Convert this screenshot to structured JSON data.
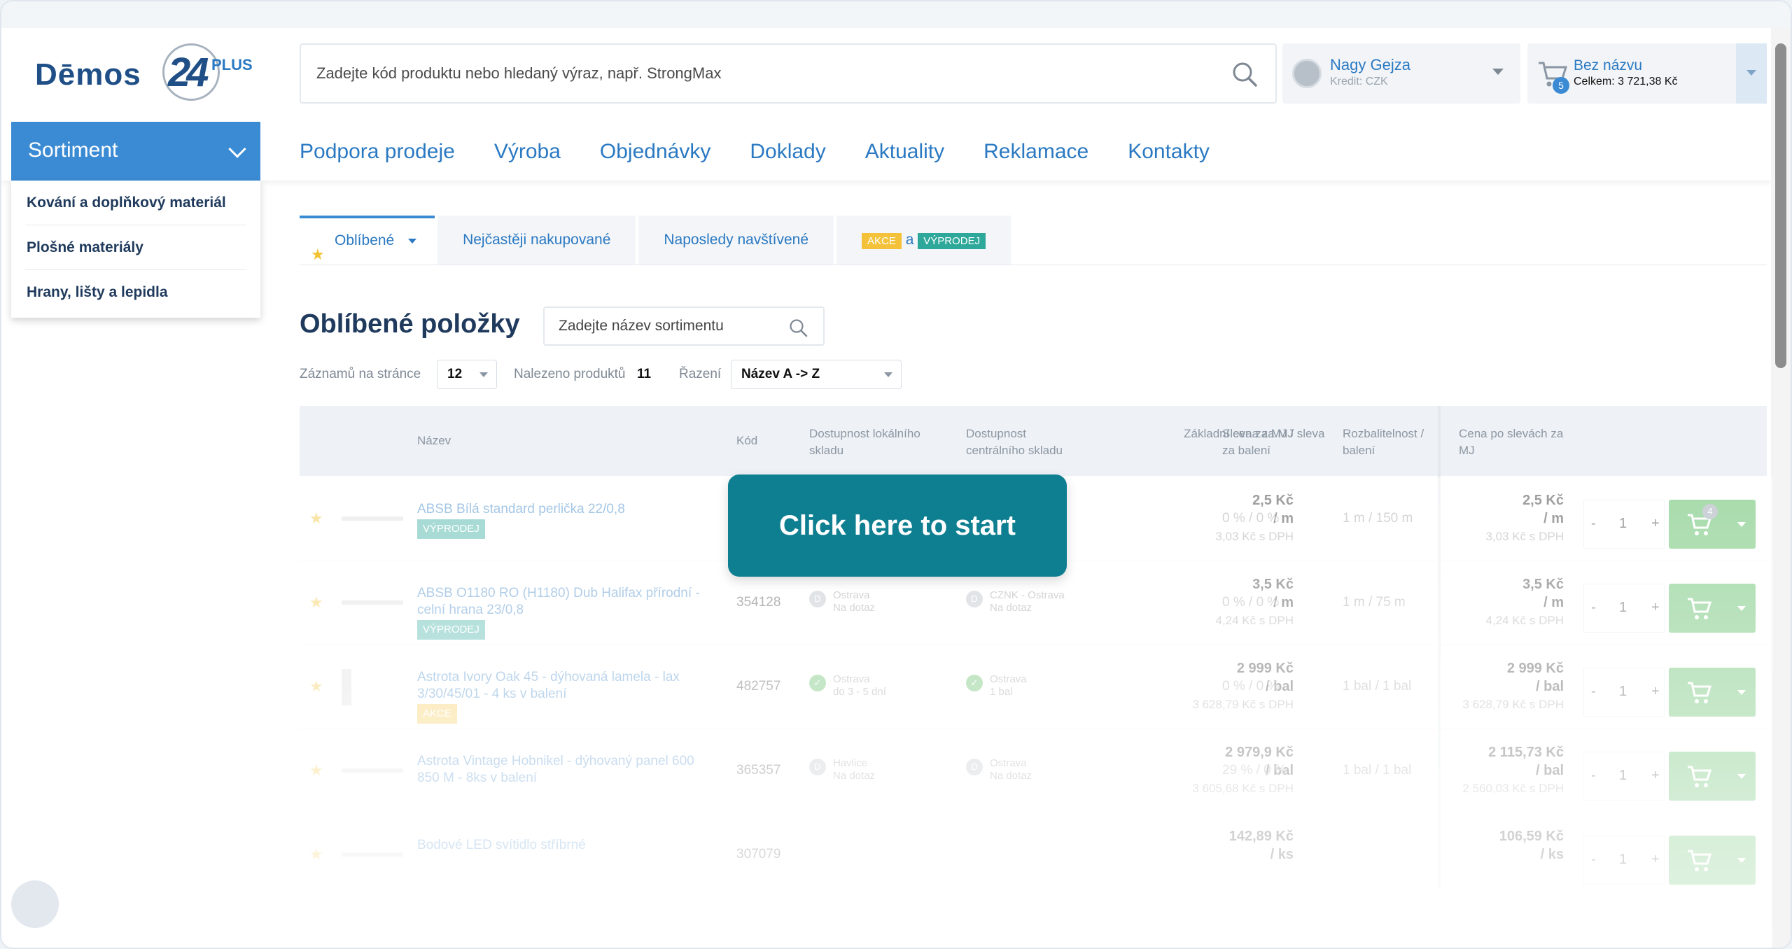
{
  "brand": {
    "name": "Dēmos",
    "number": "24",
    "plus": "PLUS"
  },
  "search": {
    "placeholder": "Zadejte kód produktu nebo hledaný výraz, např. StrongMax"
  },
  "user": {
    "name": "Nagy Gejza",
    "credit": "Kredit:  CZK"
  },
  "cart": {
    "name": "Bez názvu",
    "total": "Celkem: 3 721,38 Kč",
    "count": "5"
  },
  "sortiment": {
    "label": "Sortiment",
    "items": [
      {
        "label": "Kování a doplňkový materiál"
      },
      {
        "label": "Plošné materiály"
      },
      {
        "label": "Hrany, lišty a lepidla"
      }
    ]
  },
  "nav": [
    {
      "label": "Podpora prodeje"
    },
    {
      "label": "Výroba"
    },
    {
      "label": "Objednávky"
    },
    {
      "label": "Doklady"
    },
    {
      "label": "Aktuality"
    },
    {
      "label": "Reklamace"
    },
    {
      "label": "Kontakty"
    }
  ],
  "tabs": {
    "favorites": "Oblíbené",
    "most_bought": "Nejčastěji nakupované",
    "recent": "Naposledy navštívené",
    "akce": "AKCE",
    "and": "a",
    "vyprodej": "VÝPRODEJ"
  },
  "page": {
    "title": "Oblíbené položky",
    "assortment_placeholder": "Zadejte název sortimentu",
    "per_page_label": "Záznamů na stránce",
    "per_page_value": "12",
    "found_label": "Nalezeno produktů",
    "found_value": "11",
    "sort_label": "Řazení",
    "sort_value": "Název A -> Z"
  },
  "table": {
    "headers": {
      "name": "Název",
      "code": "Kód",
      "local_stock": "Dostupnost lokálního skladu",
      "central_stock": "Dostupnost centrálního skladu",
      "base_price": "Základní cena za MJ",
      "discount": "Sleva za MJ / sleva za balení",
      "split": "Rozbalitelnost / balení",
      "final_price": "Cena po slevách za MJ"
    },
    "rows": [
      {
        "name": "ABSB Bílá standard perlička 22/0,8",
        "tag": "VÝPRODEJ",
        "tag_color": "#2ea89a",
        "code": "",
        "local": "",
        "local_sub": "",
        "central": "",
        "central_sub": "",
        "price": "2,5 Kč",
        "unit": "/ m",
        "price_vat": "3,03 Kč s DPH",
        "discount": "0 %  /  0 %",
        "split": "1 m / 150 m",
        "final": "2,5 Kč",
        "final_unit": "/ m",
        "final_vat": "3,03 Kč s DPH",
        "qty": "1",
        "cart_count": "4"
      },
      {
        "name": "ABSB O1180 RO (H1180) Dub Halifax přírodní - celní hrana 23/0,8",
        "tag": "VÝPRODEJ",
        "tag_color": "#2ea89a",
        "code": "354128",
        "local": "Ostrava",
        "local_sub": "Na dotaz",
        "central": "CZNK - Ostrava",
        "central_sub": "Na dotaz",
        "price": "3,5 Kč",
        "unit": "/ m",
        "price_vat": "4,24 Kč s DPH",
        "discount": "0 %  /  0 %",
        "split": "1 m / 75 m",
        "final": "3,5 Kč",
        "final_unit": "/ m",
        "final_vat": "4,24 Kč s DPH",
        "qty": "1",
        "cart_count": ""
      },
      {
        "name": "Astrota Ivory Oak 45 - dýhovaná lamela - lax 3/30/45/01 - 4 ks v balení",
        "tag": "AKCE",
        "tag_color": "#f4c23a",
        "code": "482757",
        "local": "Ostrava",
        "local_sub": "do 3 - 5 dní",
        "central": "Ostrava",
        "central_sub": "1 bal",
        "price": "2 999 Kč",
        "unit": "/ bal",
        "price_vat": "3 628,79 Kč s DPH",
        "discount": "0 %  /  0 %",
        "split": "1 bal / 1 bal",
        "final": "2 999 Kč",
        "final_unit": "/ bal",
        "final_vat": "3 628,79 Kč s DPH",
        "qty": "1",
        "cart_count": ""
      },
      {
        "name": "Astrota Vintage Hobnikel - dýhovaný panel 600 850 M - 8ks v balení",
        "tag": "",
        "tag_color": "",
        "code": "365357",
        "local": "Havlice",
        "local_sub": "Na dotaz",
        "central": "Ostrava",
        "central_sub": "Na dotaz",
        "price": "2 979,9 Kč",
        "unit": "/ bal",
        "price_vat": "3 605,68 Kč s DPH",
        "discount": "29 %  /  0 %",
        "split": "1 bal / 1 bal",
        "final": "2 115,73 Kč",
        "final_unit": "/ bal",
        "final_vat": "2 560,03 Kč s DPH",
        "qty": "1",
        "cart_count": ""
      },
      {
        "name": "Bodové LED svítidlo stříbrné",
        "tag": "",
        "tag_color": "",
        "code": "307079",
        "local": "",
        "local_sub": "",
        "central": "",
        "central_sub": "",
        "price": "142,89 Kč",
        "unit": "/ ks",
        "price_vat": "",
        "discount": "",
        "split": "",
        "final": "106,59 Kč",
        "final_unit": "/ ks",
        "final_vat": "",
        "qty": "1",
        "cart_count": ""
      }
    ]
  },
  "overlay": {
    "start": "Click here to start"
  }
}
